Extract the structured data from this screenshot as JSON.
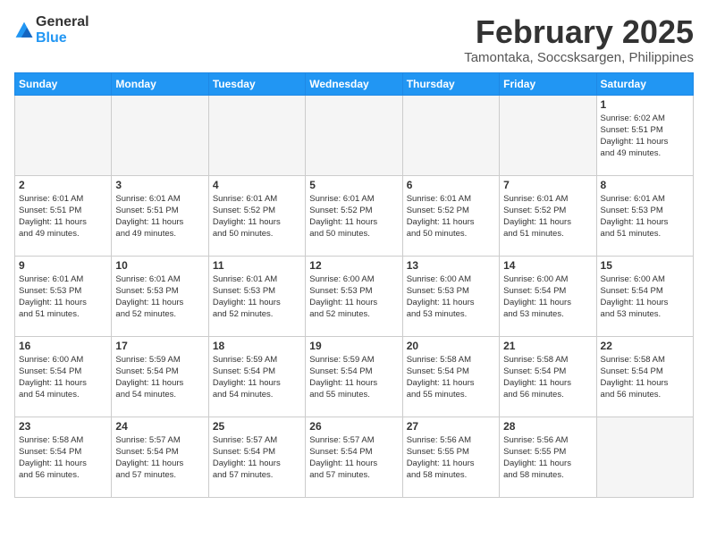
{
  "logo": {
    "general": "General",
    "blue": "Blue"
  },
  "header": {
    "month_year": "February 2025",
    "location": "Tamontaka, Soccsksargen, Philippines"
  },
  "weekdays": [
    "Sunday",
    "Monday",
    "Tuesday",
    "Wednesday",
    "Thursday",
    "Friday",
    "Saturday"
  ],
  "weeks": [
    [
      {
        "day": "",
        "info": ""
      },
      {
        "day": "",
        "info": ""
      },
      {
        "day": "",
        "info": ""
      },
      {
        "day": "",
        "info": ""
      },
      {
        "day": "",
        "info": ""
      },
      {
        "day": "",
        "info": ""
      },
      {
        "day": "1",
        "info": "Sunrise: 6:02 AM\nSunset: 5:51 PM\nDaylight: 11 hours\nand 49 minutes."
      }
    ],
    [
      {
        "day": "2",
        "info": "Sunrise: 6:01 AM\nSunset: 5:51 PM\nDaylight: 11 hours\nand 49 minutes."
      },
      {
        "day": "3",
        "info": "Sunrise: 6:01 AM\nSunset: 5:51 PM\nDaylight: 11 hours\nand 49 minutes."
      },
      {
        "day": "4",
        "info": "Sunrise: 6:01 AM\nSunset: 5:52 PM\nDaylight: 11 hours\nand 50 minutes."
      },
      {
        "day": "5",
        "info": "Sunrise: 6:01 AM\nSunset: 5:52 PM\nDaylight: 11 hours\nand 50 minutes."
      },
      {
        "day": "6",
        "info": "Sunrise: 6:01 AM\nSunset: 5:52 PM\nDaylight: 11 hours\nand 50 minutes."
      },
      {
        "day": "7",
        "info": "Sunrise: 6:01 AM\nSunset: 5:52 PM\nDaylight: 11 hours\nand 51 minutes."
      },
      {
        "day": "8",
        "info": "Sunrise: 6:01 AM\nSunset: 5:53 PM\nDaylight: 11 hours\nand 51 minutes."
      }
    ],
    [
      {
        "day": "9",
        "info": "Sunrise: 6:01 AM\nSunset: 5:53 PM\nDaylight: 11 hours\nand 51 minutes."
      },
      {
        "day": "10",
        "info": "Sunrise: 6:01 AM\nSunset: 5:53 PM\nDaylight: 11 hours\nand 52 minutes."
      },
      {
        "day": "11",
        "info": "Sunrise: 6:01 AM\nSunset: 5:53 PM\nDaylight: 11 hours\nand 52 minutes."
      },
      {
        "day": "12",
        "info": "Sunrise: 6:00 AM\nSunset: 5:53 PM\nDaylight: 11 hours\nand 52 minutes."
      },
      {
        "day": "13",
        "info": "Sunrise: 6:00 AM\nSunset: 5:53 PM\nDaylight: 11 hours\nand 53 minutes."
      },
      {
        "day": "14",
        "info": "Sunrise: 6:00 AM\nSunset: 5:54 PM\nDaylight: 11 hours\nand 53 minutes."
      },
      {
        "day": "15",
        "info": "Sunrise: 6:00 AM\nSunset: 5:54 PM\nDaylight: 11 hours\nand 53 minutes."
      }
    ],
    [
      {
        "day": "16",
        "info": "Sunrise: 6:00 AM\nSunset: 5:54 PM\nDaylight: 11 hours\nand 54 minutes."
      },
      {
        "day": "17",
        "info": "Sunrise: 5:59 AM\nSunset: 5:54 PM\nDaylight: 11 hours\nand 54 minutes."
      },
      {
        "day": "18",
        "info": "Sunrise: 5:59 AM\nSunset: 5:54 PM\nDaylight: 11 hours\nand 54 minutes."
      },
      {
        "day": "19",
        "info": "Sunrise: 5:59 AM\nSunset: 5:54 PM\nDaylight: 11 hours\nand 55 minutes."
      },
      {
        "day": "20",
        "info": "Sunrise: 5:58 AM\nSunset: 5:54 PM\nDaylight: 11 hours\nand 55 minutes."
      },
      {
        "day": "21",
        "info": "Sunrise: 5:58 AM\nSunset: 5:54 PM\nDaylight: 11 hours\nand 56 minutes."
      },
      {
        "day": "22",
        "info": "Sunrise: 5:58 AM\nSunset: 5:54 PM\nDaylight: 11 hours\nand 56 minutes."
      }
    ],
    [
      {
        "day": "23",
        "info": "Sunrise: 5:58 AM\nSunset: 5:54 PM\nDaylight: 11 hours\nand 56 minutes."
      },
      {
        "day": "24",
        "info": "Sunrise: 5:57 AM\nSunset: 5:54 PM\nDaylight: 11 hours\nand 57 minutes."
      },
      {
        "day": "25",
        "info": "Sunrise: 5:57 AM\nSunset: 5:54 PM\nDaylight: 11 hours\nand 57 minutes."
      },
      {
        "day": "26",
        "info": "Sunrise: 5:57 AM\nSunset: 5:54 PM\nDaylight: 11 hours\nand 57 minutes."
      },
      {
        "day": "27",
        "info": "Sunrise: 5:56 AM\nSunset: 5:55 PM\nDaylight: 11 hours\nand 58 minutes."
      },
      {
        "day": "28",
        "info": "Sunrise: 5:56 AM\nSunset: 5:55 PM\nDaylight: 11 hours\nand 58 minutes."
      },
      {
        "day": "",
        "info": ""
      }
    ]
  ]
}
